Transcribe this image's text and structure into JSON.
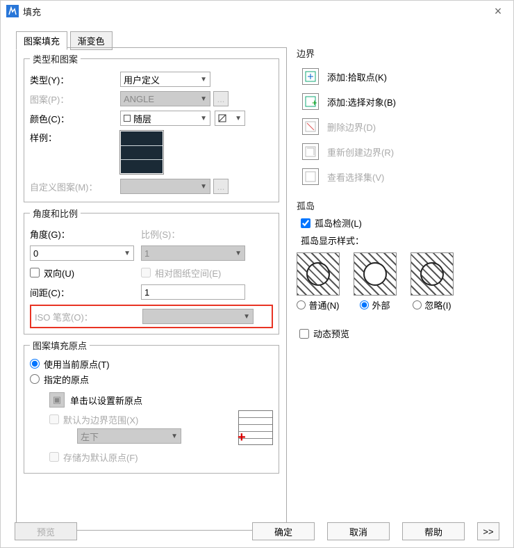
{
  "window": {
    "title": "填充",
    "close": "×"
  },
  "tabs": {
    "fill": "图案填充",
    "grad": "渐变色"
  },
  "typePattern": {
    "legend": "类型和图案",
    "typeLabel": "类型(Y)：",
    "typeValue": "用户定义",
    "patternLabel": "图案(P)：",
    "patternValue": "ANGLE",
    "colorLabel": "颜色(C)：",
    "colorValue": "随层",
    "swatchLabel": "样例：",
    "customLabel": "自定义图案(M)："
  },
  "angleScale": {
    "legend": "角度和比例",
    "angleLabel": "角度(G)：",
    "angleValue": "0",
    "scaleLabel": "比例(S)：",
    "scaleValue": "1",
    "bidir": "双向(U)",
    "paperSpace": "相对图纸空间(E)",
    "spacingLabel": "间距(C)：",
    "spacingValue": "1",
    "isoLabel": "ISO 笔宽(O)："
  },
  "origin": {
    "legend": "图案填充原点",
    "useCurrent": "使用当前原点(T)",
    "specify": "指定的原点",
    "clickSet": "单击以设置新原点",
    "defaultBound": "默认为边界范围(X)",
    "posValue": "左下",
    "storeDefault": "存储为默认原点(F)"
  },
  "boundary": {
    "legend": "边界",
    "pick": "添加:拾取点(K)",
    "select": "添加:选择对象(B)",
    "delete": "删除边界(D)",
    "recreate": "重新创建边界(R)",
    "viewSel": "查看选择集(V)"
  },
  "islands": {
    "legend": "孤岛",
    "detect": "孤岛检测(L)",
    "styleLabel": "孤岛显示样式：",
    "normal": "普通(N)",
    "outer": "外部",
    "ignore": "忽略(I)"
  },
  "dynPreview": "动态预览",
  "buttons": {
    "preview": "预览",
    "ok": "确定",
    "cancel": "取消",
    "help": "帮助",
    "expand": ">>"
  },
  "misc": {
    "ellipsis": "..."
  }
}
